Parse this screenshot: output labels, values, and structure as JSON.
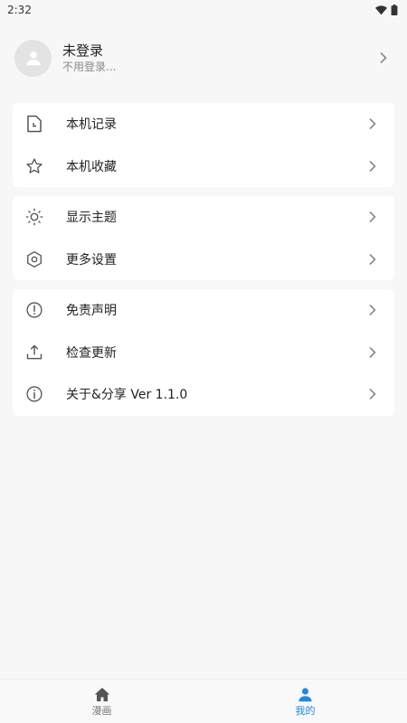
{
  "status_bar": {
    "time": "2:32"
  },
  "profile": {
    "name": "未登录",
    "subtitle": "不用登录..."
  },
  "groups": [
    {
      "items": [
        {
          "label": "本机记录",
          "icon": "history-doc-icon"
        },
        {
          "label": "本机收藏",
          "icon": "star-icon"
        }
      ]
    },
    {
      "items": [
        {
          "label": "显示主题",
          "icon": "brightness-icon"
        },
        {
          "label": "更多设置",
          "icon": "settings-hex-icon"
        }
      ]
    },
    {
      "items": [
        {
          "label": "免责声明",
          "icon": "alert-circle-icon"
        },
        {
          "label": "检查更新",
          "icon": "upload-icon"
        },
        {
          "label": "关于&分享 Ver 1.1.0",
          "icon": "info-icon"
        }
      ]
    }
  ],
  "bottom_nav": [
    {
      "label": "漫画",
      "icon": "home-icon",
      "active": false
    },
    {
      "label": "我的",
      "icon": "person-icon",
      "active": true
    }
  ],
  "colors": {
    "accent": "#1e88e5",
    "background": "#f7f7f7",
    "card": "#ffffff"
  }
}
